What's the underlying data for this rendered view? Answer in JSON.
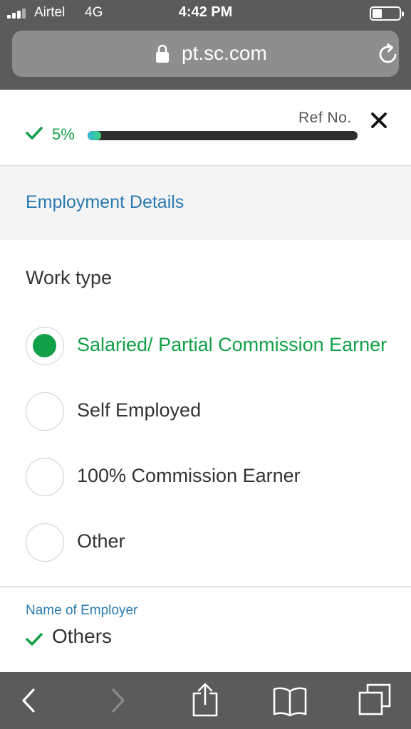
{
  "status_bar": {
    "carrier": "Airtel",
    "network": "4G",
    "time": "4:42 PM",
    "battery_level": 0.35
  },
  "browser": {
    "url": "pt.sc.com",
    "icons": {
      "lock": "lock-icon",
      "reload": "reload-icon"
    }
  },
  "progress": {
    "percent_label": "5%",
    "percent_value": 5,
    "ref_label": "Ref No.",
    "icons": {
      "check": "check-icon",
      "close": "close-icon"
    }
  },
  "section": {
    "title": "Employment Details"
  },
  "work_type": {
    "label": "Work type",
    "options": [
      {
        "label": "Salaried/ Partial Commission Earner",
        "selected": true
      },
      {
        "label": "Self Employed",
        "selected": false
      },
      {
        "label": "100% Commission Earner",
        "selected": false
      },
      {
        "label": "Other",
        "selected": false
      }
    ]
  },
  "employer": {
    "label": "Name of Employer",
    "value": "Others"
  },
  "toolbar": {
    "icons": [
      "back-icon",
      "forward-icon",
      "share-icon",
      "bookmarks-icon",
      "tabs-icon"
    ]
  },
  "colors": {
    "accent_green": "#12a048",
    "link_blue": "#2a7ab0",
    "chrome_gray": "#5b5b5b"
  }
}
